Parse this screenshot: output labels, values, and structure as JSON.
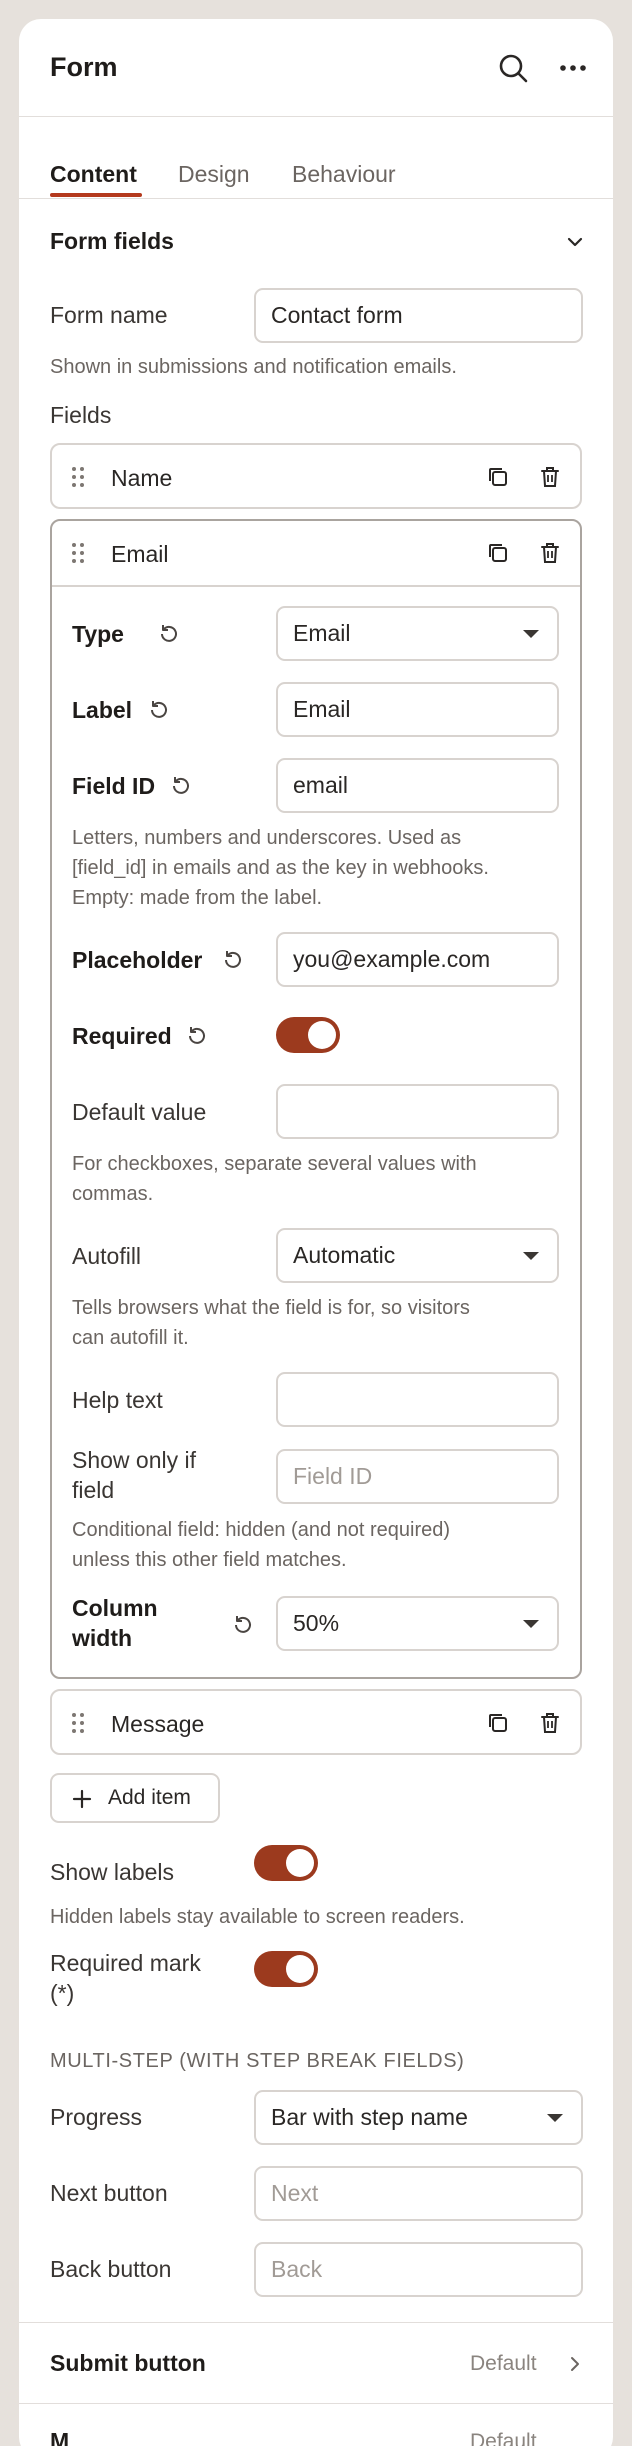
{
  "header": {
    "title": "Form"
  },
  "tabs": [
    {
      "label": "Content"
    },
    {
      "label": "Design"
    },
    {
      "label": "Behaviour"
    }
  ],
  "section": {
    "title": "Form fields"
  },
  "form_name": {
    "label": "Form name",
    "value": "Contact form",
    "help": "Shown in submissions and notification emails."
  },
  "fields": {
    "title": "Fields",
    "items": [
      {
        "label": "Name"
      },
      {
        "label": "Email"
      },
      {
        "label": "Message"
      }
    ]
  },
  "email_field": {
    "type": {
      "label": "Type",
      "value": "Email"
    },
    "label": {
      "label": "Label",
      "value": "Email"
    },
    "field_id": {
      "label": "Field ID",
      "value": "email",
      "help_1": "Letters, numbers and underscores. Used as",
      "help_2": "[field_id] in emails and as the key in webhooks.",
      "help_3": "Empty: made from the label."
    },
    "placeholder": {
      "label": "Placeholder",
      "value": "you@example.com"
    },
    "required": {
      "label": "Required",
      "on": true
    },
    "default_value": {
      "label": "Default value",
      "value": "",
      "help_1": "For checkboxes, separate several values with",
      "help_2": "commas."
    },
    "autofill": {
      "label": "Autofill",
      "value": "Automatic",
      "help_1": "Tells browsers what the field is for, so visitors",
      "help_2": "can autofill it."
    },
    "help_text": {
      "label": "Help text",
      "value": ""
    },
    "show_only_if": {
      "label_1": "Show only if",
      "label_2": "field",
      "placeholder": "Field ID",
      "help_1": "Conditional field: hidden (and not required)",
      "help_2": "unless this other field matches."
    },
    "column_width": {
      "label_1": "Column",
      "label_2": "width",
      "value": "50%"
    }
  },
  "add_item": {
    "label": "Add item"
  },
  "show_labels": {
    "label": "Show labels",
    "on": true,
    "help": "Hidden labels stay available to screen readers."
  },
  "required_mark": {
    "label_1": "Required mark",
    "label_2": "(*)",
    "on": true
  },
  "multistep": {
    "heading": "MULTI-STEP (WITH STEP BREAK FIELDS)",
    "progress": {
      "label": "Progress",
      "value": "Bar with step name"
    },
    "next_button": {
      "label": "Next button",
      "placeholder": "Next"
    },
    "back_button": {
      "label": "Back button",
      "placeholder": "Back"
    }
  },
  "submit_button": {
    "label": "Submit button",
    "value": "Default"
  },
  "next_section_partial": {
    "label": "M",
    "value": "Default"
  },
  "colors": {
    "accent": "#b4391d",
    "toggle_on": "#9c3a1e",
    "border": "#d8d3cf",
    "background": "#e6e1dc"
  },
  "icons": {
    "search": "search-icon",
    "more": "more-horizontal-icon",
    "chevron": "chevron-down-icon",
    "duplicate": "duplicate-icon",
    "trash": "trash-icon",
    "reset": "reset-icon",
    "drag": "drag-handle-icon",
    "plus": "plus-icon",
    "chevron_right": "chevron-right-icon"
  }
}
